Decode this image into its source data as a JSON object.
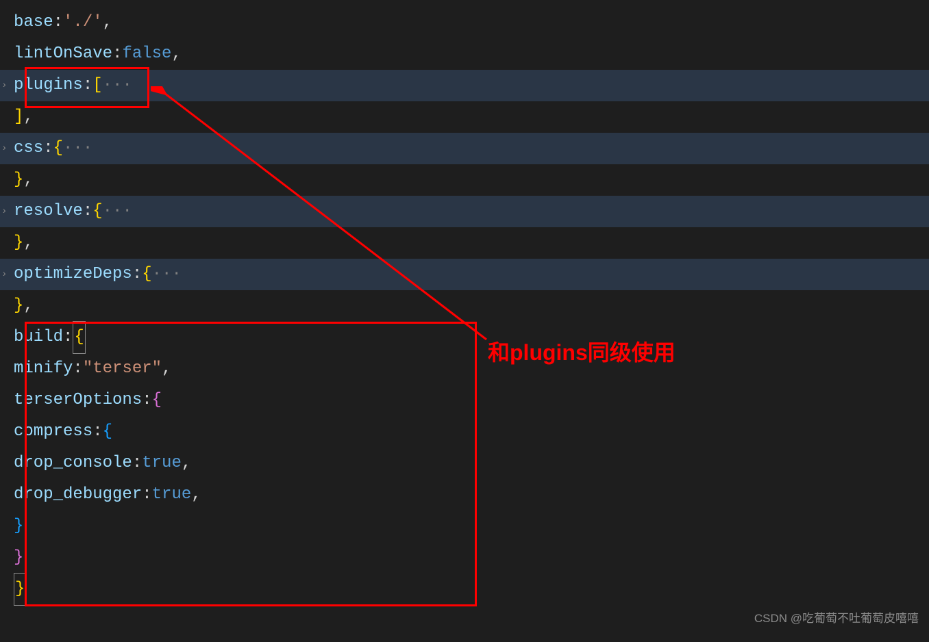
{
  "code": {
    "line1_prop": "base",
    "line1_val": "'./'",
    "line2_prop": "lintOnSave",
    "line2_val": "false",
    "line3_prop": "plugins",
    "line5_prop": "css",
    "line7_prop": "resolve",
    "line9_prop": "optimizeDeps",
    "line11_prop": "build",
    "line12_prop": "minify",
    "line12_val": "\"terser\"",
    "line13_prop": "terserOptions",
    "line14_prop": "compress",
    "line15_prop": "drop_console",
    "line15_val": "true",
    "line16_prop": "drop_debugger",
    "line16_val": "true",
    "ellipsis": "···",
    "colon": ":",
    "comma": ",",
    "lbrace": "{",
    "rbrace": "}",
    "lbracket": "[",
    "rbracket": "]"
  },
  "annotation": "和plugins同级使用",
  "watermark": "CSDN @吃葡萄不吐葡萄皮嘻嘻",
  "fold_arrow": "›"
}
